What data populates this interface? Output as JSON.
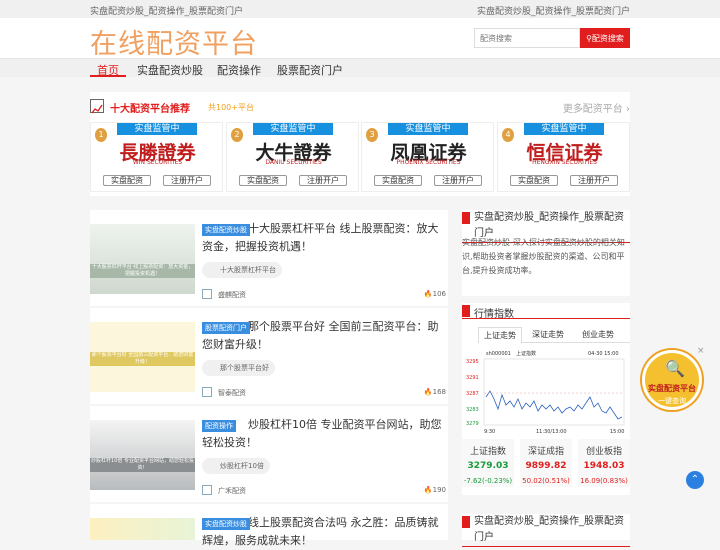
{
  "topbar": {
    "left": "实盘配资炒股_配资操作_股票配资门户",
    "right": "实盘配资炒股_配资操作_股票配资门户"
  },
  "header": {
    "logo": "在线配资平台"
  },
  "search": {
    "placeholder": "配资搜索",
    "button": "配资搜索"
  },
  "nav": [
    "首页",
    "实盘配资炒股",
    "配资操作",
    "股票配资门户"
  ],
  "banner": {
    "title": "十大配资平台推荐",
    "sub": "共100+平台",
    "more": "更多配资平台",
    "badge": "实盘监管中",
    "open": "实盘配资",
    "register": "注册开户",
    "brokers": [
      {
        "num": "1",
        "name": "長勝證券",
        "en": "WIN SECURITIES",
        "color": "#c01e1e"
      },
      {
        "num": "2",
        "name": "大牛證券",
        "en": "DANIU SECURITIES",
        "color": "#222222"
      },
      {
        "num": "3",
        "name": "凤凰证券",
        "en": "PHOENIX SECURITIES",
        "color": "#222222"
      },
      {
        "num": "4",
        "name": "恒信证券",
        "en": "HENGXIN SECURITIES",
        "color": "#c01e1e"
      }
    ]
  },
  "articles": [
    {
      "cat": "实盘配资炒股",
      "title": "十大股票杠杆平台 线上股票配资：放大资金，把握投资机遇！",
      "tag": "十大股票杠杆平台",
      "src": "盛麒配资",
      "views": "106",
      "thumb_text": "十大股票杠杆平台 线上股票配资：放大资金，把握投资机遇！"
    },
    {
      "cat": "股票配资门户",
      "title": "那个股票平台好 全国前三配资平台：助您财富升级！",
      "tag": "那个股票平台好",
      "src": "智泰配资",
      "views": "168",
      "thumb_text": "那个股票平台好 全国前三配资平台：助您财富升级！"
    },
    {
      "cat": "配资操作",
      "title": "炒股杠杆10倍 专业配资平台网站，助您轻松投资！",
      "tag": "炒股杠杆10倍",
      "src": "广禾配资",
      "views": "190",
      "thumb_text": "炒股杠杆10倍 专业配资平台网站，助您轻松投资！"
    },
    {
      "cat": "实盘配资炒股",
      "title": "线上股票配资合法吗 永之胜：品质铸就辉煌，服务成就未来！",
      "tag": "",
      "src": "",
      "views": "",
      "thumb_text": ""
    }
  ],
  "sidebar": {
    "about_title": "实盘配资炒股_配资操作_股票配资门户",
    "about_desc": "实盘配资炒股-深入探讨实盘配资炒股的相关知识,帮助投资者掌握炒股配资的渠道、公司和平台,提升投资成功率。",
    "market_title": "行情指数",
    "tabs": [
      "上证走势",
      "深证走势",
      "创业走势"
    ],
    "chart_code": "sh000001",
    "chart_name": "上证指数",
    "chart_time": "04-30 15:00",
    "chart_x": [
      "9:30",
      "11:30/13:00",
      "15:00"
    ],
    "chart_y": [
      "3295",
      "3291",
      "3287",
      "3283",
      "3279"
    ],
    "indices": [
      {
        "name": "上证指数",
        "value": "3279.03",
        "change": "-7.62(-0.23%)",
        "color": "#1a9a3a"
      },
      {
        "name": "深证成指",
        "value": "9899.82",
        "change": "50.02(0.51%)",
        "color": "#e01e1e"
      },
      {
        "name": "创业板指",
        "value": "1948.03",
        "change": "16.09(0.83%)",
        "color": "#e01e1e"
      }
    ],
    "second_title": "实盘配资炒股_配资操作_股票配资门户"
  },
  "float": {
    "t1": "实盘配资平台",
    "t2": "一键查询"
  }
}
